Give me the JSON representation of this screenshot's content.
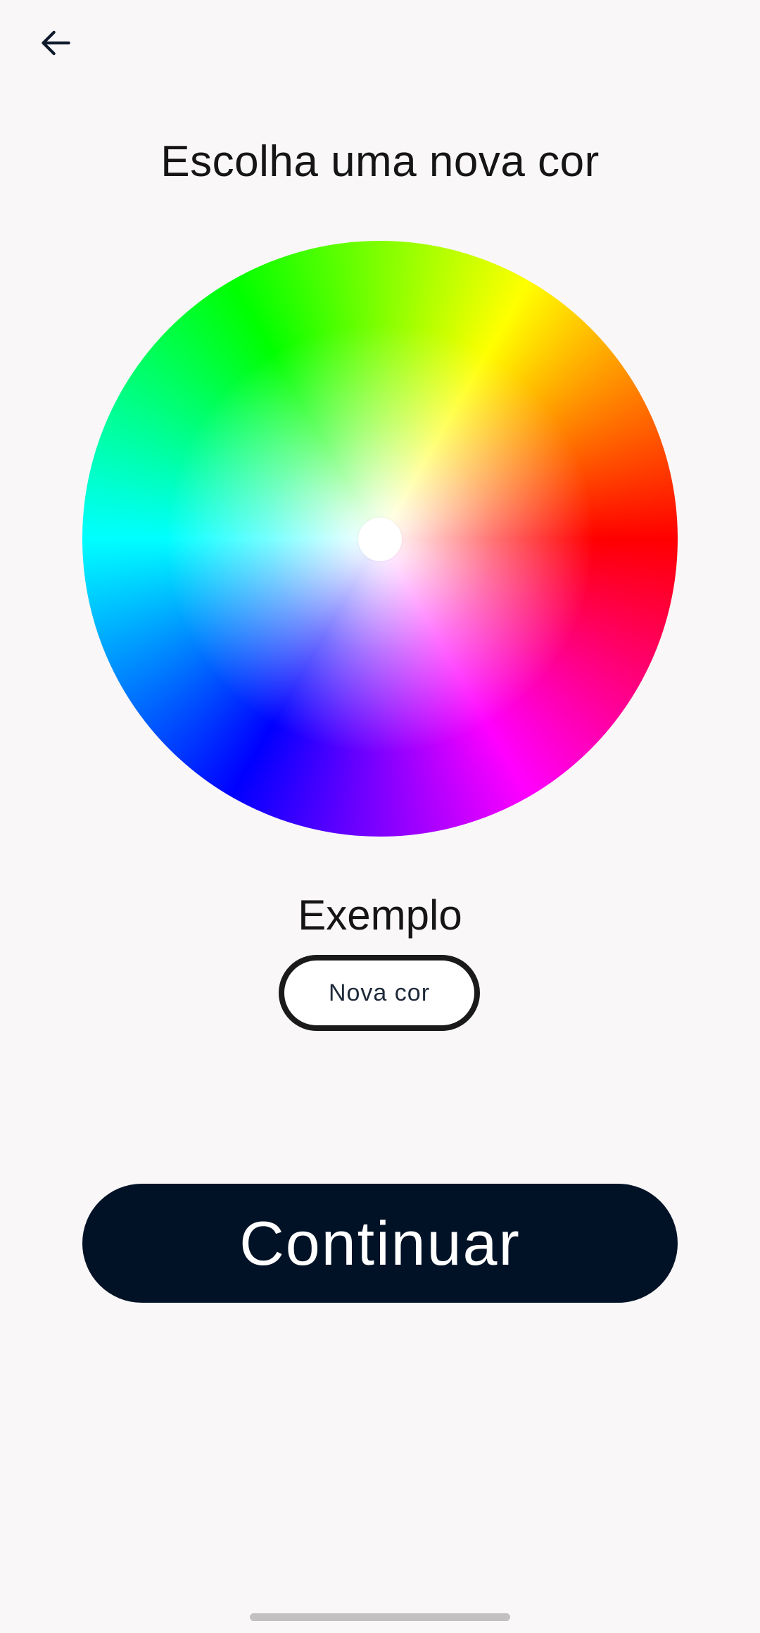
{
  "header": {
    "back_icon": "arrow-left-icon",
    "title": "Escolha uma nova cor"
  },
  "color_picker": {
    "type": "hue-saturation-wheel",
    "selected_color": "#ffffff"
  },
  "preview": {
    "label": "Exemplo",
    "button_label": "Nova cor"
  },
  "actions": {
    "continue_label": "Continuar"
  },
  "colors": {
    "background": "#f9f7f8",
    "primary_button": "#021226",
    "preview_border": "#1a1a1a",
    "text": "#151515"
  }
}
